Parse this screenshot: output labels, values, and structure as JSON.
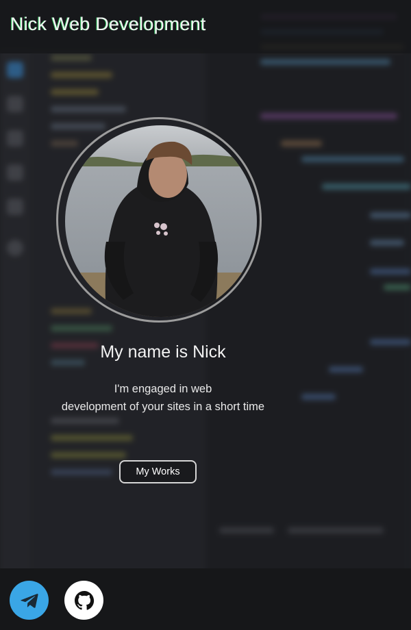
{
  "header": {
    "brand": "Nick Web Development"
  },
  "hero": {
    "title": "My name is Nick",
    "subtitle_line1": "I'm engaged in web",
    "subtitle_line2": "development of your sites in a short time",
    "works_button": "My Works"
  },
  "footer": {
    "social": [
      {
        "icon": "telegram-icon",
        "color": "#3aa6e6"
      },
      {
        "icon": "github-icon",
        "color": "#ffffff"
      }
    ]
  },
  "colors": {
    "background": "#1e1f23",
    "header": "#16171a",
    "accent_green": "#38d46a",
    "telegram_blue": "#3aa6e6"
  }
}
